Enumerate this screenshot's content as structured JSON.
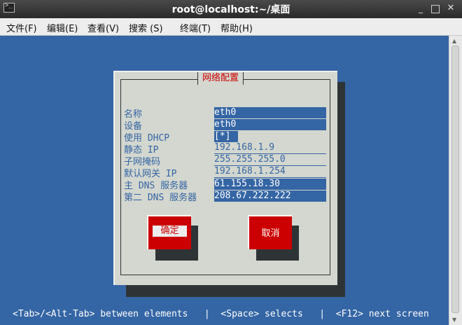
{
  "window": {
    "title": "root@localhost:~/桌面",
    "min_label": "_",
    "close_label": "✕"
  },
  "menu": [
    {
      "label": "文件(F)"
    },
    {
      "label": "编辑(E)"
    },
    {
      "label": "查看(V)"
    },
    {
      "label": "搜索 (S)"
    },
    {
      "label": "终端(T)"
    },
    {
      "label": "帮助(H)"
    }
  ],
  "dialog": {
    "title": "网络配置",
    "fields": [
      {
        "label": "名称",
        "value": "eth0"
      },
      {
        "label": "设备",
        "value": "eth0"
      },
      {
        "label": "使用 DHCP",
        "value": "[*]"
      },
      {
        "label": "静态 IP",
        "value": "192.168.1.9"
      },
      {
        "label": "子网掩码",
        "value": "255.255.255.0"
      },
      {
        "label": "默认网关 IP",
        "value": "192.168.1.254"
      },
      {
        "label": "主 DNS 服务器",
        "value": "61.155.18.30"
      },
      {
        "label": "第二 DNS 服务器",
        "value": "208.67.222.222"
      }
    ],
    "ok_label": "确定",
    "cancel_label": "取消"
  },
  "statusbar": {
    "text": "<Tab>/<Alt-Tab> between elements   |  <Space> selects   |  <F12> next screen"
  },
  "colors": {
    "terminal_bg": "#3465a4",
    "dialog_bg": "#d3d7cf",
    "accent_red": "#cc0000"
  }
}
